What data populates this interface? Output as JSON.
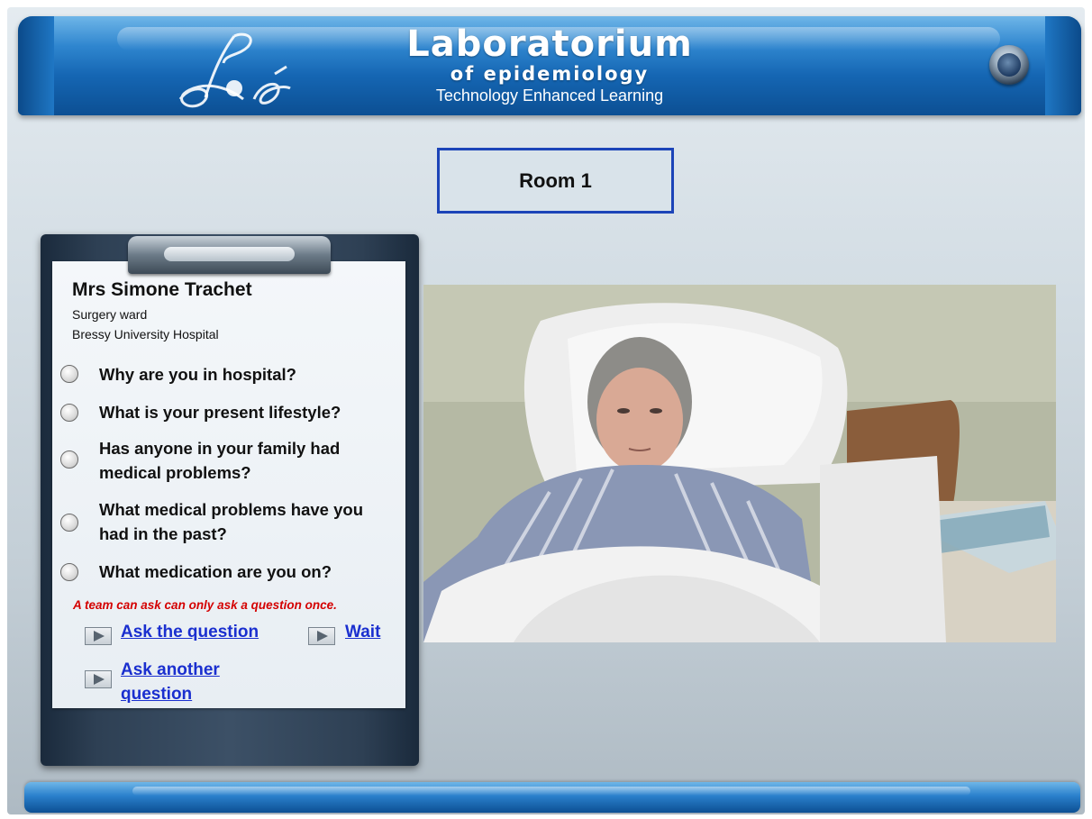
{
  "header": {
    "title": "Laboratorium",
    "subtitle": "of epidemiology",
    "tagline": "Technology Enhanced Learning",
    "logo_text": "LoE"
  },
  "room": {
    "label": "Room 1"
  },
  "patient": {
    "name": "Mrs Simone Trachet",
    "ward": "Surgery ward",
    "hospital": "Bressy University Hospital"
  },
  "questions": [
    "Why are you in hospital?",
    "What is your present lifestyle?",
    "Has anyone in your family had medical problems?",
    "What medical problems have you had in the past?",
    "What medication are you on?"
  ],
  "notice": "A team can ask can only ask a question once.",
  "actions": {
    "ask": "Ask the question",
    "wait": "Wait",
    "ask_another": "Ask another question"
  },
  "colors": {
    "header_blue": "#1566b3",
    "link_blue": "#1a2fcf",
    "notice_red": "#d40000",
    "room_border": "#1c44b8"
  }
}
